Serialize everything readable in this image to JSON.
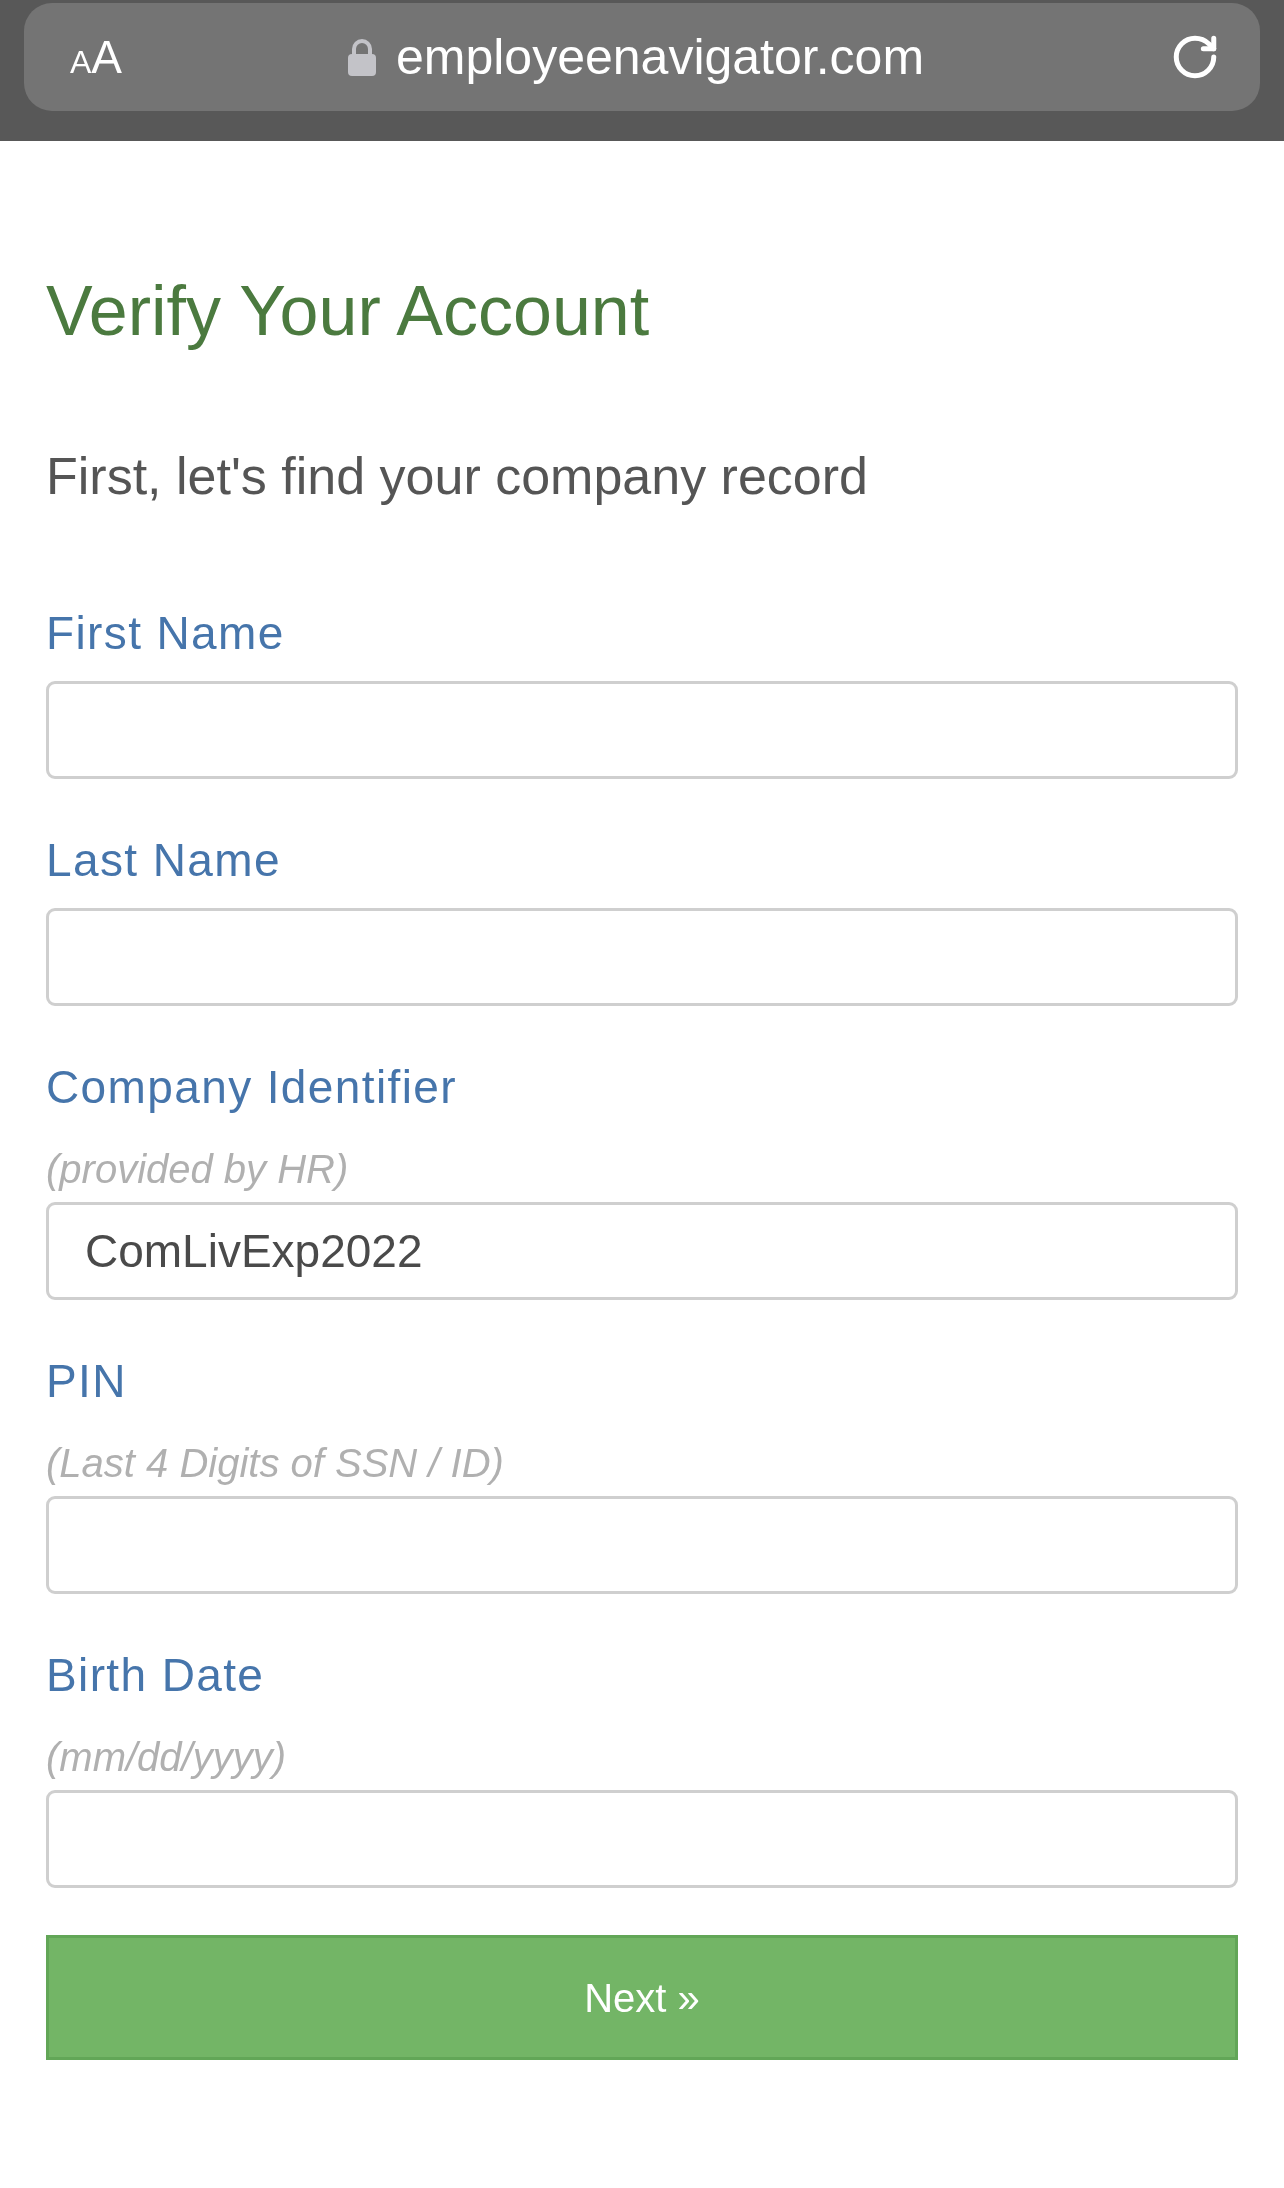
{
  "browser_bar": {
    "text_size_button": {
      "small": "A",
      "large": "A"
    },
    "url": "employeenavigator.com"
  },
  "page": {
    "title": "Verify Your Account",
    "subtitle": "First, let's find your company record",
    "fields": [
      {
        "label": "First Name"
      },
      {
        "label": "Last Name"
      },
      {
        "label": "Company Identifier",
        "hint": "(provided by HR)",
        "value": "ComLivExp2022"
      },
      {
        "label": "PIN",
        "hint": "(Last 4 Digits of SSN / ID)"
      },
      {
        "label": "Birth Date",
        "hint": "(mm/dd/yyyy)"
      }
    ],
    "submit_button": {
      "label": "Next »"
    }
  }
}
